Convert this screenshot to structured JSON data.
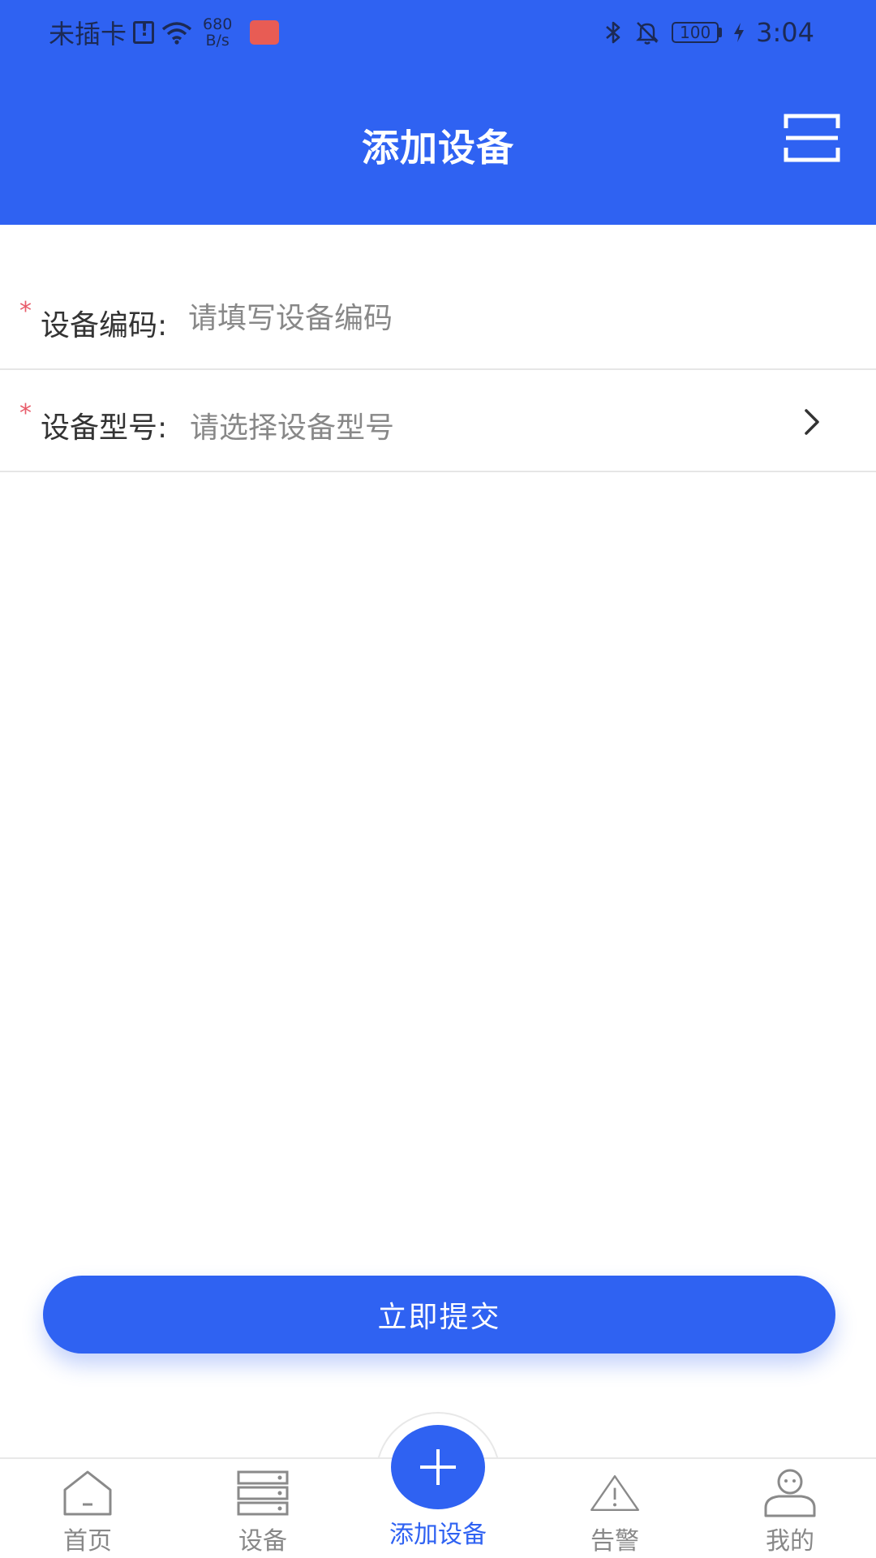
{
  "status_bar": {
    "carrier": "未插卡",
    "net_speed_value": "680",
    "net_speed_unit": "B/s",
    "battery": "100",
    "time": "3:04"
  },
  "header": {
    "title": "添加设备",
    "scan_icon": "scan-frame-icon"
  },
  "form": {
    "code": {
      "required_mark": "*",
      "label": "设备编码:",
      "placeholder": "请填写设备编码",
      "value": ""
    },
    "model": {
      "required_mark": "*",
      "label": "设备型号:",
      "placeholder": "请选择设备型号",
      "icon": "chevron-right-icon"
    }
  },
  "submit": {
    "label": "立即提交"
  },
  "tabbar": {
    "items": [
      {
        "label": "首页",
        "icon": "home-icon",
        "active": false
      },
      {
        "label": "设备",
        "icon": "device-list-icon",
        "active": false
      },
      {
        "label": "添加设备",
        "icon": "plus-icon",
        "active": true
      },
      {
        "label": "告警",
        "icon": "warning-icon",
        "active": false
      },
      {
        "label": "我的",
        "icon": "user-icon",
        "active": false
      }
    ]
  },
  "colors": {
    "primary": "#2f62f2",
    "required": "#e85c6a",
    "placeholder": "#888888",
    "text": "#333333"
  }
}
